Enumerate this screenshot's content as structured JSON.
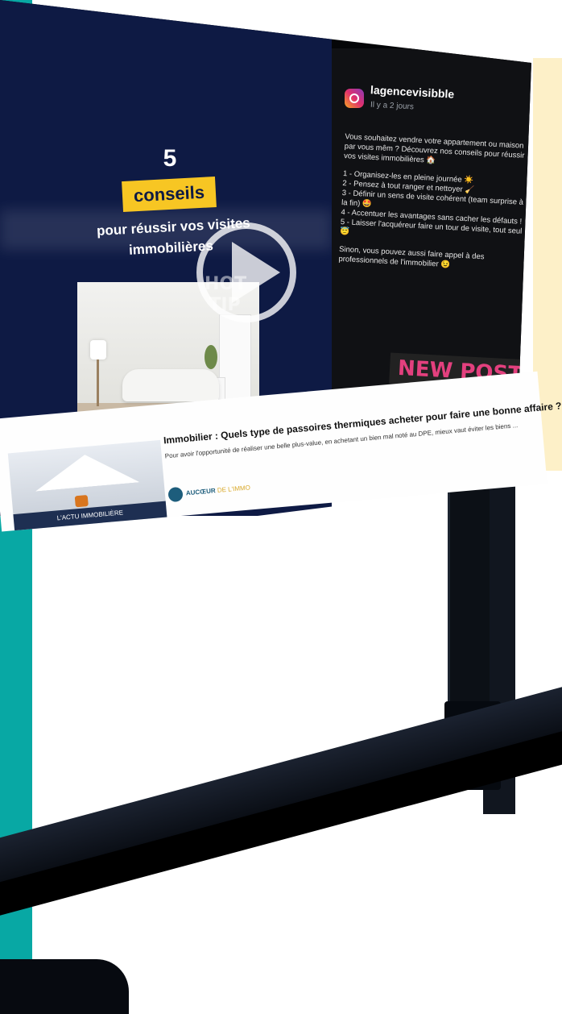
{
  "video": {
    "number": "5",
    "badge": "conseils",
    "line1": "pour réussir vos visites",
    "line2": "immobilières",
    "overlay": "HOT TIP"
  },
  "instagram": {
    "username": "lagencevisibble",
    "time": "Il y a 2 jours",
    "intro": "Vous souhaitez vendre votre appartement ou maison par vous mêm ? Découvrez nos conseils pour réussir vos visites immobilières 🏠",
    "tips": [
      "1 - Organisez-les en pleine journée ☀️",
      "2 - Pensez à tout ranger et nettoyer 🧹",
      "3 - Définir un sens de visite cohérent (team surprise à la fin) 🤩",
      "4 - Accentuer les avantages sans cacher les défauts !",
      "5 - Laisser l'acquéreur faire un tour de visite, tout seul 😇"
    ],
    "outro": "Sinon, vous pouvez aussi faire appel à des professionnels de l'immobilier 😉",
    "badge": "NEW POST"
  },
  "article": {
    "image_label": "L'ACTU IMMOBILIÈRE",
    "title": "Immobilier : Quels type de passoires thermiques acheter pour faire une bonne affaire ? - MySweetimmo",
    "description": "Pour avoir l'opportunité de réaliser une belle plus-value, en achetant un bien mal noté au DPE, mieux vaut éviter les biens ...",
    "brand": "AUCŒUR",
    "brand_suffix": "DE L'IMMO"
  },
  "colors": {
    "teal": "#08a8a4",
    "navy": "#0e1a44",
    "yellow": "#f7c623",
    "cream": "#fdf0c8",
    "pink": "#e3407e"
  }
}
